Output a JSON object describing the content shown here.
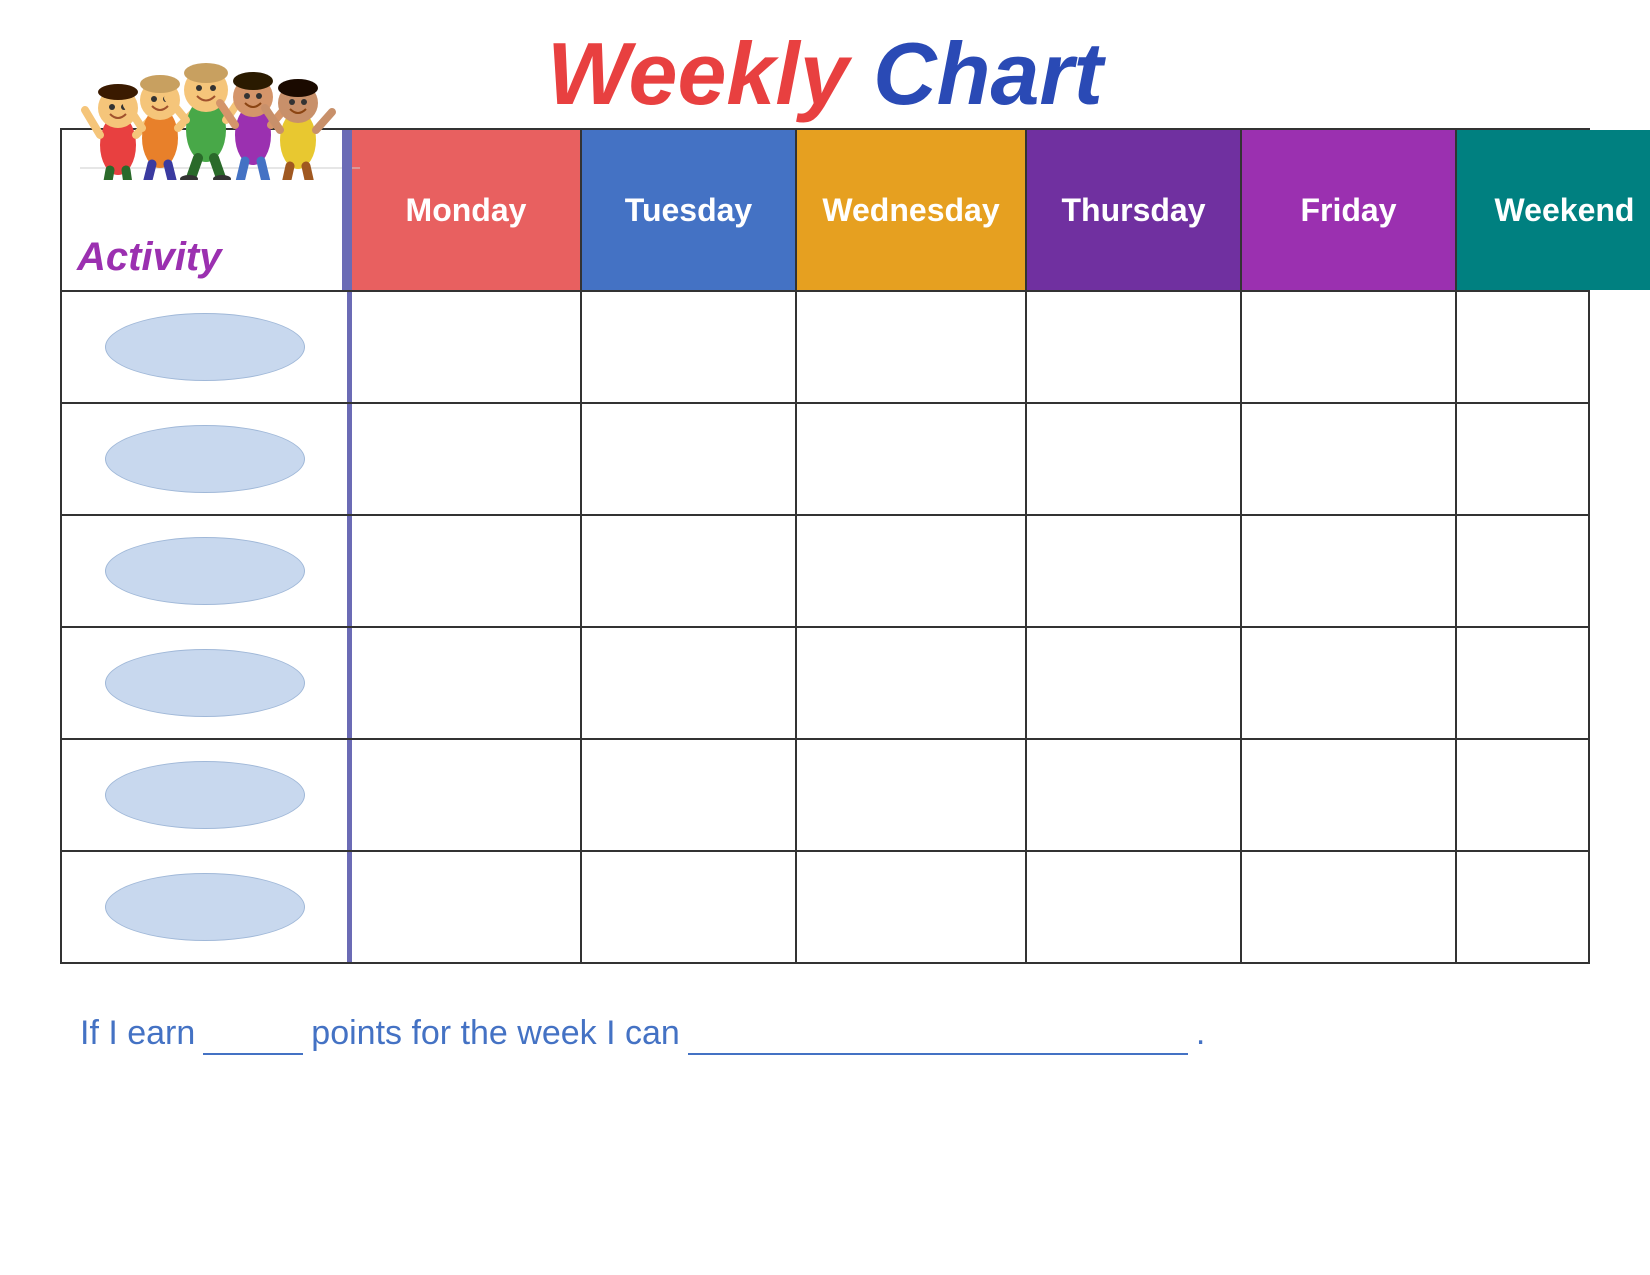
{
  "title": {
    "weekly": "Weekly",
    "chart": "Chart"
  },
  "activity_label": "Activity",
  "days": [
    {
      "label": "Monday",
      "class": "day-monday"
    },
    {
      "label": "Tuesday",
      "class": "day-tuesday"
    },
    {
      "label": "Wednesday",
      "class": "day-wednesday"
    },
    {
      "label": "Thursday",
      "class": "day-thursday"
    },
    {
      "label": "Friday",
      "class": "day-friday"
    },
    {
      "label": "Weekend",
      "class": "day-weekend"
    }
  ],
  "rows": 6,
  "footer": {
    "text_before": "If I earn",
    "text_middle": "points for the week I can",
    "text_end": "."
  }
}
